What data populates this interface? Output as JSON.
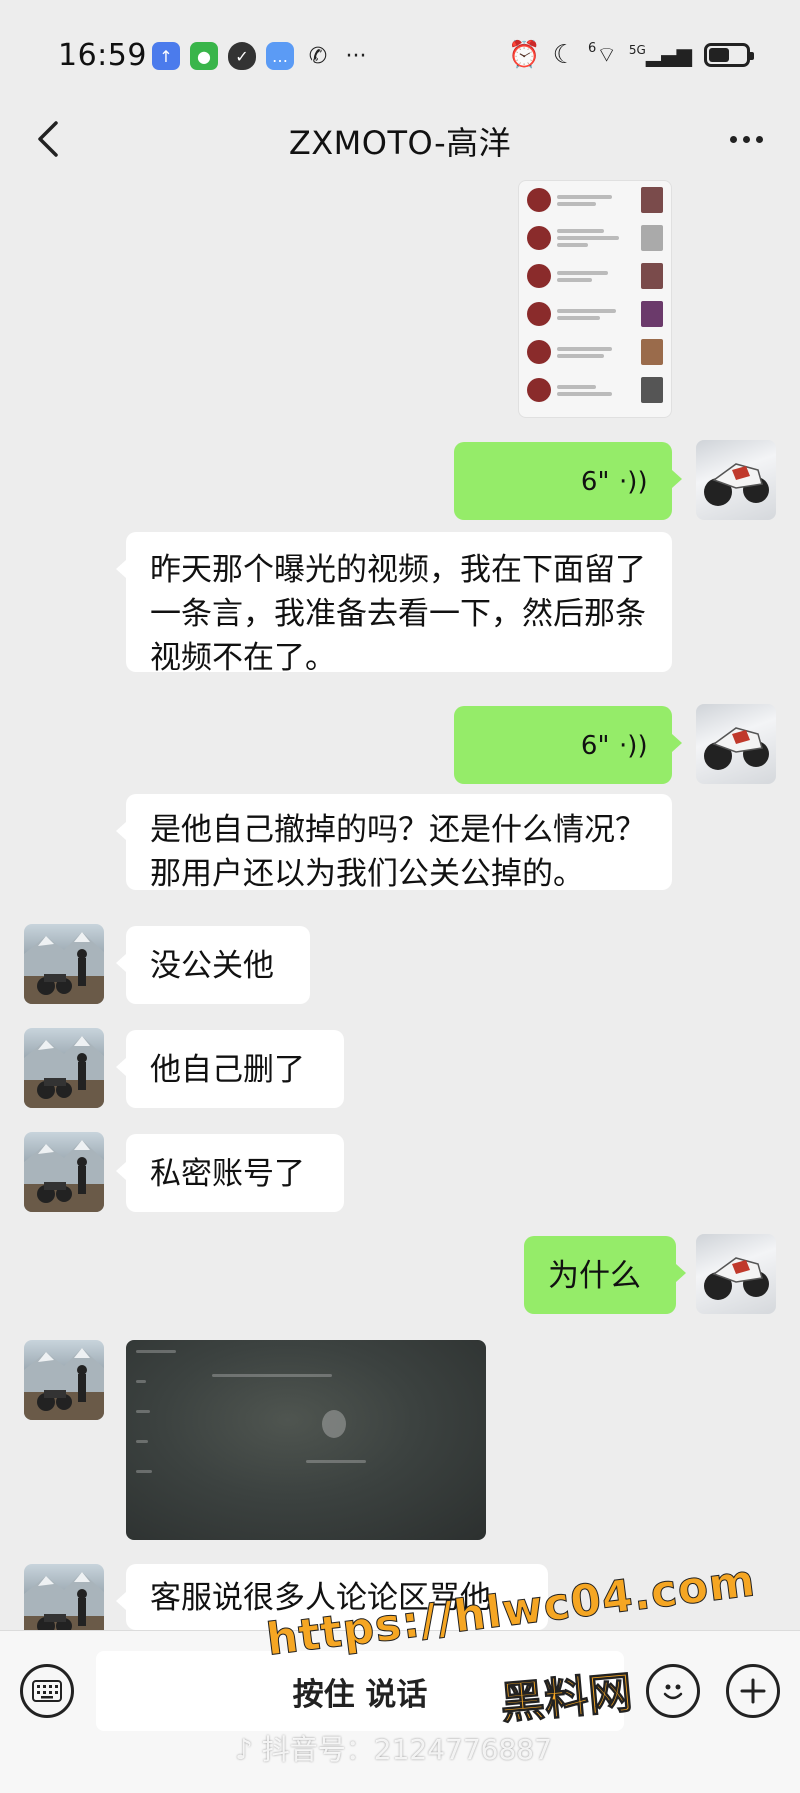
{
  "status_bar": {
    "time": "16:59",
    "left_icons": [
      "upload-icon",
      "wechat-icon",
      "shield-icon",
      "message-icon",
      "missed-call-icon",
      "more-dots"
    ],
    "more_text": "···",
    "signal_label": "5G",
    "wifi_label": "6",
    "battery_level": 0.55
  },
  "header": {
    "title": "ZXMOTO-高洋"
  },
  "messages": [
    {
      "type": "image",
      "side": "left",
      "content": "screenshot-list"
    },
    {
      "type": "voice",
      "side": "right",
      "duration": "6\""
    },
    {
      "type": "text",
      "side": "right",
      "text": "昨天那个曝光的视频，我在下面留了一条言，我准备去看一下，然后那条视频不在了。"
    },
    {
      "type": "voice",
      "side": "right",
      "duration": "6\""
    },
    {
      "type": "text",
      "side": "right",
      "text": "是他自己撤掉的吗？还是什么情况？那用户还以为我们公关公掉的。"
    },
    {
      "type": "text",
      "side": "left",
      "text": "没公关他"
    },
    {
      "type": "text",
      "side": "left",
      "text": "他自己删了"
    },
    {
      "type": "text",
      "side": "left",
      "text": "私密账号了"
    },
    {
      "type": "text",
      "side": "right",
      "text": "为什么"
    },
    {
      "type": "image",
      "side": "left",
      "content": "blurry-photo"
    },
    {
      "type": "text",
      "side": "left",
      "text": "客服说很多人论论区骂他"
    }
  ],
  "input_bar": {
    "hold_to_talk": "按住 说话"
  },
  "watermarks": {
    "url": "https://hlwc04.com",
    "name": "黑料网",
    "douyin": "抖音号：2124776887"
  },
  "colors": {
    "background": "#ededed",
    "green_bubble": "#95ec69",
    "white_bubble": "#ffffff",
    "watermark": "#f5a623"
  }
}
